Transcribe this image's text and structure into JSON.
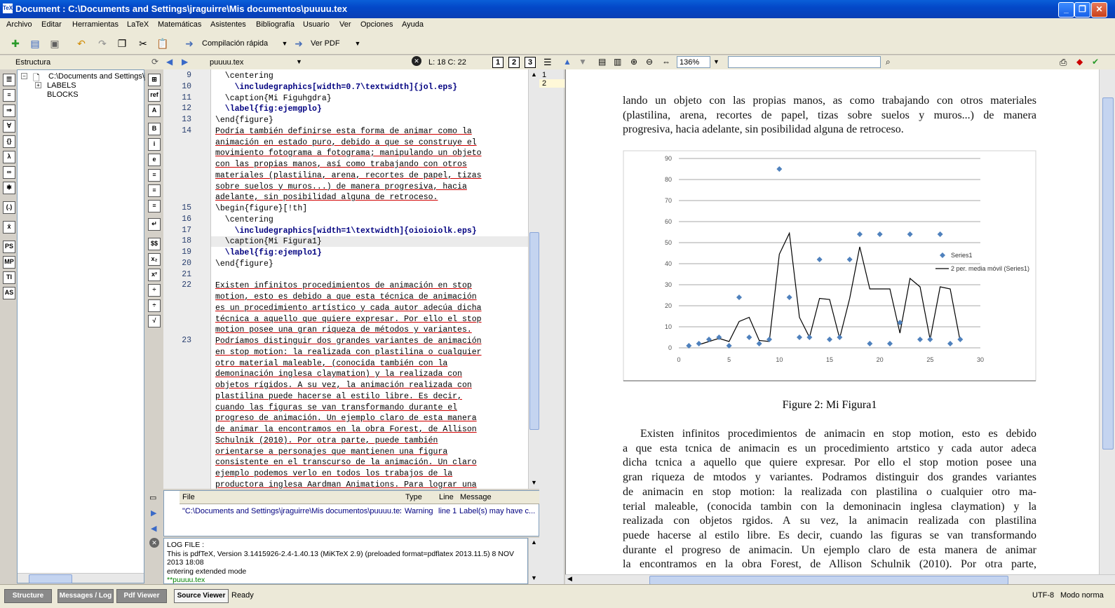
{
  "window": {
    "title": "Document : C:\\Documents and Settings\\jraguirre\\Mis documentos\\puuuu.tex"
  },
  "menu": [
    "Archivo",
    "Editar",
    "Herramientas",
    "LaTeX",
    "Matemáticas",
    "Asistentes",
    "Bibliografía",
    "Usuario",
    "Ver",
    "Opciones",
    "Ayuda"
  ],
  "toolbar": {
    "compile_label": "Compilación rápida",
    "view_label": "Ver PDF"
  },
  "structure": {
    "header": "Estructura",
    "root": "C:\\Documents and Settings\\j",
    "labels": "LABELS",
    "blocks": "BLOCKS"
  },
  "editor": {
    "tab": "puuuu.tex",
    "cursor": "L: 18 C: 22",
    "numbers": [
      "1",
      "2",
      "3"
    ],
    "lines": [
      {
        "n": "9",
        "t": "  \\centering"
      },
      {
        "n": "10",
        "t": "    \\includegraphics[width=0.7\\textwidth]{jol.eps}"
      },
      {
        "n": "11",
        "t": "  \\caption{Mi Figuhgdra}"
      },
      {
        "n": "12",
        "t": "  \\label{fig:ejemgplo}"
      },
      {
        "n": "13",
        "t": "\\end{figure}"
      },
      {
        "n": "14",
        "t": "Podría también definirse esta forma de animar como la"
      },
      {
        "n": "",
        "t": "animación en estado puro, debido a que se construye el"
      },
      {
        "n": "",
        "t": "movimiento fotograma a fotograma; manipulando un objeto"
      },
      {
        "n": "",
        "t": "con las propias manos, así como trabajando con otros"
      },
      {
        "n": "",
        "t": "materiales (plastilina, arena, recortes de papel, tizas"
      },
      {
        "n": "",
        "t": "sobre suelos y muros...) de manera progresiva, hacia"
      },
      {
        "n": "",
        "t": "adelante, sin posibilidad alguna de retroceso."
      },
      {
        "n": "15",
        "t": "\\begin{figure}[!th]"
      },
      {
        "n": "16",
        "t": "  \\centering"
      },
      {
        "n": "17",
        "t": "    \\includegraphics[width=1\\textwidth]{oioioiolk.eps}"
      },
      {
        "n": "18",
        "t": "  \\caption{Mi Figura1}"
      },
      {
        "n": "19",
        "t": "  \\label{fig:ejemplo1}"
      },
      {
        "n": "20",
        "t": "\\end{figure}"
      },
      {
        "n": "21",
        "t": ""
      },
      {
        "n": "22",
        "t": "Existen infinitos procedimientos de animación en stop"
      },
      {
        "n": "",
        "t": "motion, esto es debido a que esta técnica de animación"
      },
      {
        "n": "",
        "t": "es un procedimiento artístico y cada autor adecúa dicha"
      },
      {
        "n": "",
        "t": "técnica a aquello que quiere expresar. Por ello el stop"
      },
      {
        "n": "",
        "t": "motion posee una gran riqueza de métodos y variantes."
      },
      {
        "n": "23",
        "t": "Podríamos distinguir dos grandes variantes de animación"
      },
      {
        "n": "",
        "t": "en stop motion: la realizada con plastilina o cualquier"
      },
      {
        "n": "",
        "t": "otro material maleable, (conocida también con la"
      },
      {
        "n": "",
        "t": "demoninación inglesa claymation) y la realizada con"
      },
      {
        "n": "",
        "t": "objetos rígidos. A su vez, la animación realizada con"
      },
      {
        "n": "",
        "t": "plastilina puede hacerse al estilo libre. Es decir,"
      },
      {
        "n": "",
        "t": "cuando las figuras se van transformando durante el"
      },
      {
        "n": "",
        "t": "progreso de animación. Un ejemplo claro de esta manera"
      },
      {
        "n": "",
        "t": "de animar la encontramos en la obra Forest, de Allison"
      },
      {
        "n": "",
        "t": "Schulnik (2010). Por otra parte, puede también"
      },
      {
        "n": "",
        "t": "orientarse a personajes que mantienen una figura"
      },
      {
        "n": "",
        "t": "consistente en el transcurso de la animación. Un claro"
      },
      {
        "n": "",
        "t": "ejemplo podemos verlo en todos los trabajos de la"
      },
      {
        "n": "",
        "t": "productora inglesa Aardman Animations. Para lograr una"
      }
    ]
  },
  "messages": {
    "headers": [
      "File",
      "Type",
      "Line",
      "Message"
    ],
    "row": {
      "file": "\"C:\\Documents and Settings\\jraguirre\\Mis documentos\\puuuu.tex",
      "type": "Warning",
      "line": "line 1",
      "message": "Label(s) may have c..."
    }
  },
  "log": [
    "LOG FILE :",
    "This is pdfTeX, Version 3.1415926-2.4-1.40.13 (MiKTeX 2.9) (preloaded format=pdflatex 2013.11.5) 8 NOV",
    "2013 18:08",
    "entering extended mode",
    "**puuuu.tex"
  ],
  "pdf_toolbar": {
    "zoom": "136%",
    "page_nums": [
      "1",
      "2"
    ]
  },
  "pdf": {
    "para1": [
      "lando un objeto con las propias manos, as como trabajando con otros materiales",
      "(plastilina, arena, recortes de papel, tizas sobre suelos y muros...)  de manera",
      "progresiva, hacia adelante, sin posibilidad alguna de retroceso."
    ],
    "caption": "Figure 2:  Mi Figura1",
    "para2": [
      "Existen infinitos procedimientos de animacin en stop motion, esto es debido",
      "a que esta tcnica de animacin es un procedimiento artstico y cada autor adeca",
      "dicha tcnica a aquello que quiere expresar.  Por ello el stop motion posee una",
      "gran riqueza de mtodos y variantes.  Podramos distinguir dos grandes variantes",
      "de animacin en stop motion:  la realizada con plastilina o cualquier otro ma-",
      "terial maleable, (conocida tambin con la demoninacin inglesa claymation) y la",
      "realizada con objetos rgidos.  A su vez, la animacin realizada con plastilina",
      "puede hacerse al estilo libre.  Es decir, cuando las figuras se van transformando",
      "durante el progreso de animacin.  Un ejemplo claro de esta manera de animar",
      "la encontramos en la obra Forest, de Allison Schulnik (2010).  Por otra parte,"
    ]
  },
  "chart_data": {
    "type": "scatter",
    "xlim": [
      0,
      30
    ],
    "ylim": [
      0,
      90
    ],
    "xticks": [
      0,
      5,
      10,
      15,
      20,
      25,
      30
    ],
    "yticks": [
      0,
      10,
      20,
      30,
      40,
      50,
      60,
      70,
      80,
      90
    ],
    "legend_position": "right",
    "series": [
      {
        "name": "Series1",
        "kind": "scatter",
        "color": "#4f81bd",
        "x": [
          1,
          2,
          3,
          4,
          5,
          6,
          7,
          8,
          9,
          10,
          11,
          12,
          13,
          14,
          15,
          16,
          17,
          18,
          19,
          20,
          21,
          22,
          23,
          24,
          25,
          26,
          27,
          28
        ],
        "y": [
          1,
          2,
          4,
          5,
          1,
          24,
          5,
          2,
          4,
          85,
          24,
          5,
          5,
          42,
          4,
          5,
          42,
          54,
          2,
          54,
          2,
          12,
          54,
          4,
          4,
          54,
          2,
          4
        ]
      },
      {
        "name": "2 per. media móvil (Series1)",
        "kind": "line",
        "color": "#000000",
        "x": [
          2,
          3,
          4,
          5,
          6,
          7,
          8,
          9,
          10,
          11,
          12,
          13,
          14,
          15,
          16,
          17,
          18,
          19,
          20,
          21,
          22,
          23,
          24,
          25,
          26,
          27,
          28
        ],
        "y": [
          1.5,
          3,
          4.5,
          3,
          12.5,
          14.5,
          3.5,
          3,
          44.5,
          54.5,
          14.5,
          5,
          23.5,
          23,
          4.5,
          23.5,
          48,
          28,
          28,
          28,
          7,
          33,
          29,
          4,
          29,
          28,
          3
        ]
      }
    ]
  },
  "status": {
    "tabs": [
      "Structure",
      "Messages / Log",
      "Pdf Viewer",
      "Source Viewer"
    ],
    "active_tab": "Source Viewer",
    "ready": "Ready",
    "encoding": "UTF-8",
    "mode": "Modo norma"
  }
}
